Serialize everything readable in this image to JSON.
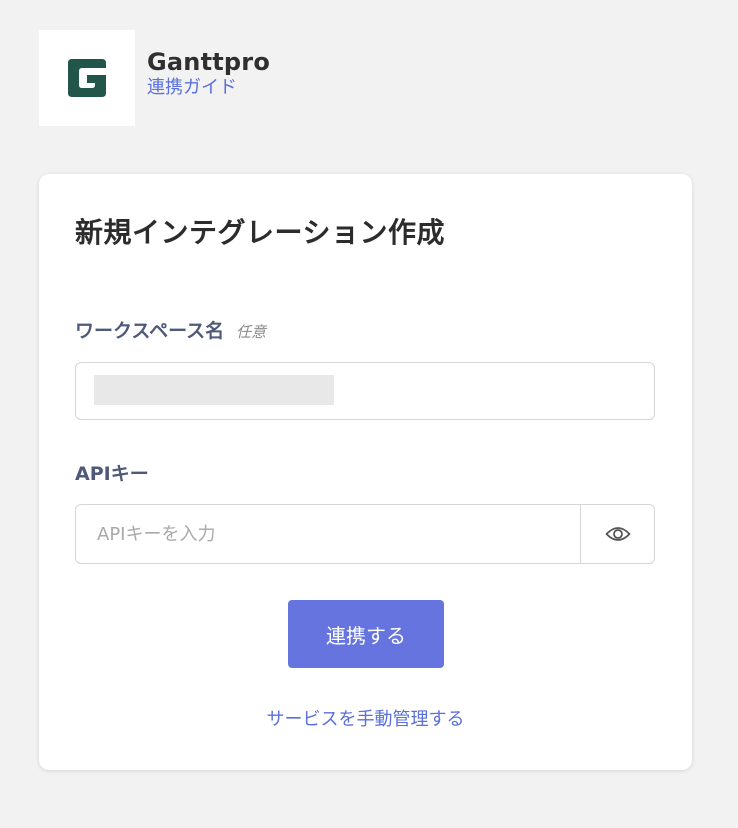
{
  "app": {
    "name": "Ganttpro",
    "guide_link": "連携ガイド",
    "logo_letter": "G",
    "logo_color": "#22564a"
  },
  "form": {
    "title": "新規インテグレーション作成",
    "workspace": {
      "label": "ワークスペース名",
      "optional_tag": "任意",
      "value": ""
    },
    "api_key": {
      "label": "APIキー",
      "placeholder": "APIキーを入力",
      "toggle_icon": "eye-icon"
    },
    "submit_label": "連携する",
    "manual_link": "サービスを手動管理する"
  },
  "colors": {
    "accent": "#6674df",
    "link": "#5b70d9",
    "label": "#4e5a78",
    "background": "#f2f2f2"
  }
}
